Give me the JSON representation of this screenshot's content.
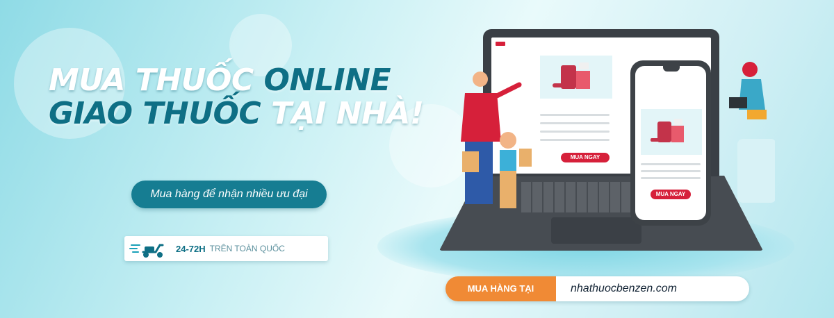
{
  "banner": {
    "headline": {
      "line1": {
        "part_white": "MUA THUỐC",
        "part_teal": "ONLINE"
      },
      "line2": {
        "part_teal": "GIAO THUỐC",
        "part_white": "TẠI NHÀ!"
      }
    },
    "promo_pill": "Mua hàng để nhận nhiều ưu đại",
    "delivery": {
      "time": "24-72H",
      "area": "TRÊN TOÀN QUỐC",
      "icon": "scooter-icon"
    },
    "laptop": {
      "buy_label": "MUA NGAY"
    },
    "phone": {
      "buy_label": "MUA NGAY"
    },
    "cta": {
      "label": "MUA HÀNG TẠI",
      "url": "nhathuocbenzen.com"
    },
    "colors": {
      "teal": "#0e6f85",
      "pill": "#167d92",
      "orange": "#f08a35",
      "red": "#d6203a"
    }
  }
}
